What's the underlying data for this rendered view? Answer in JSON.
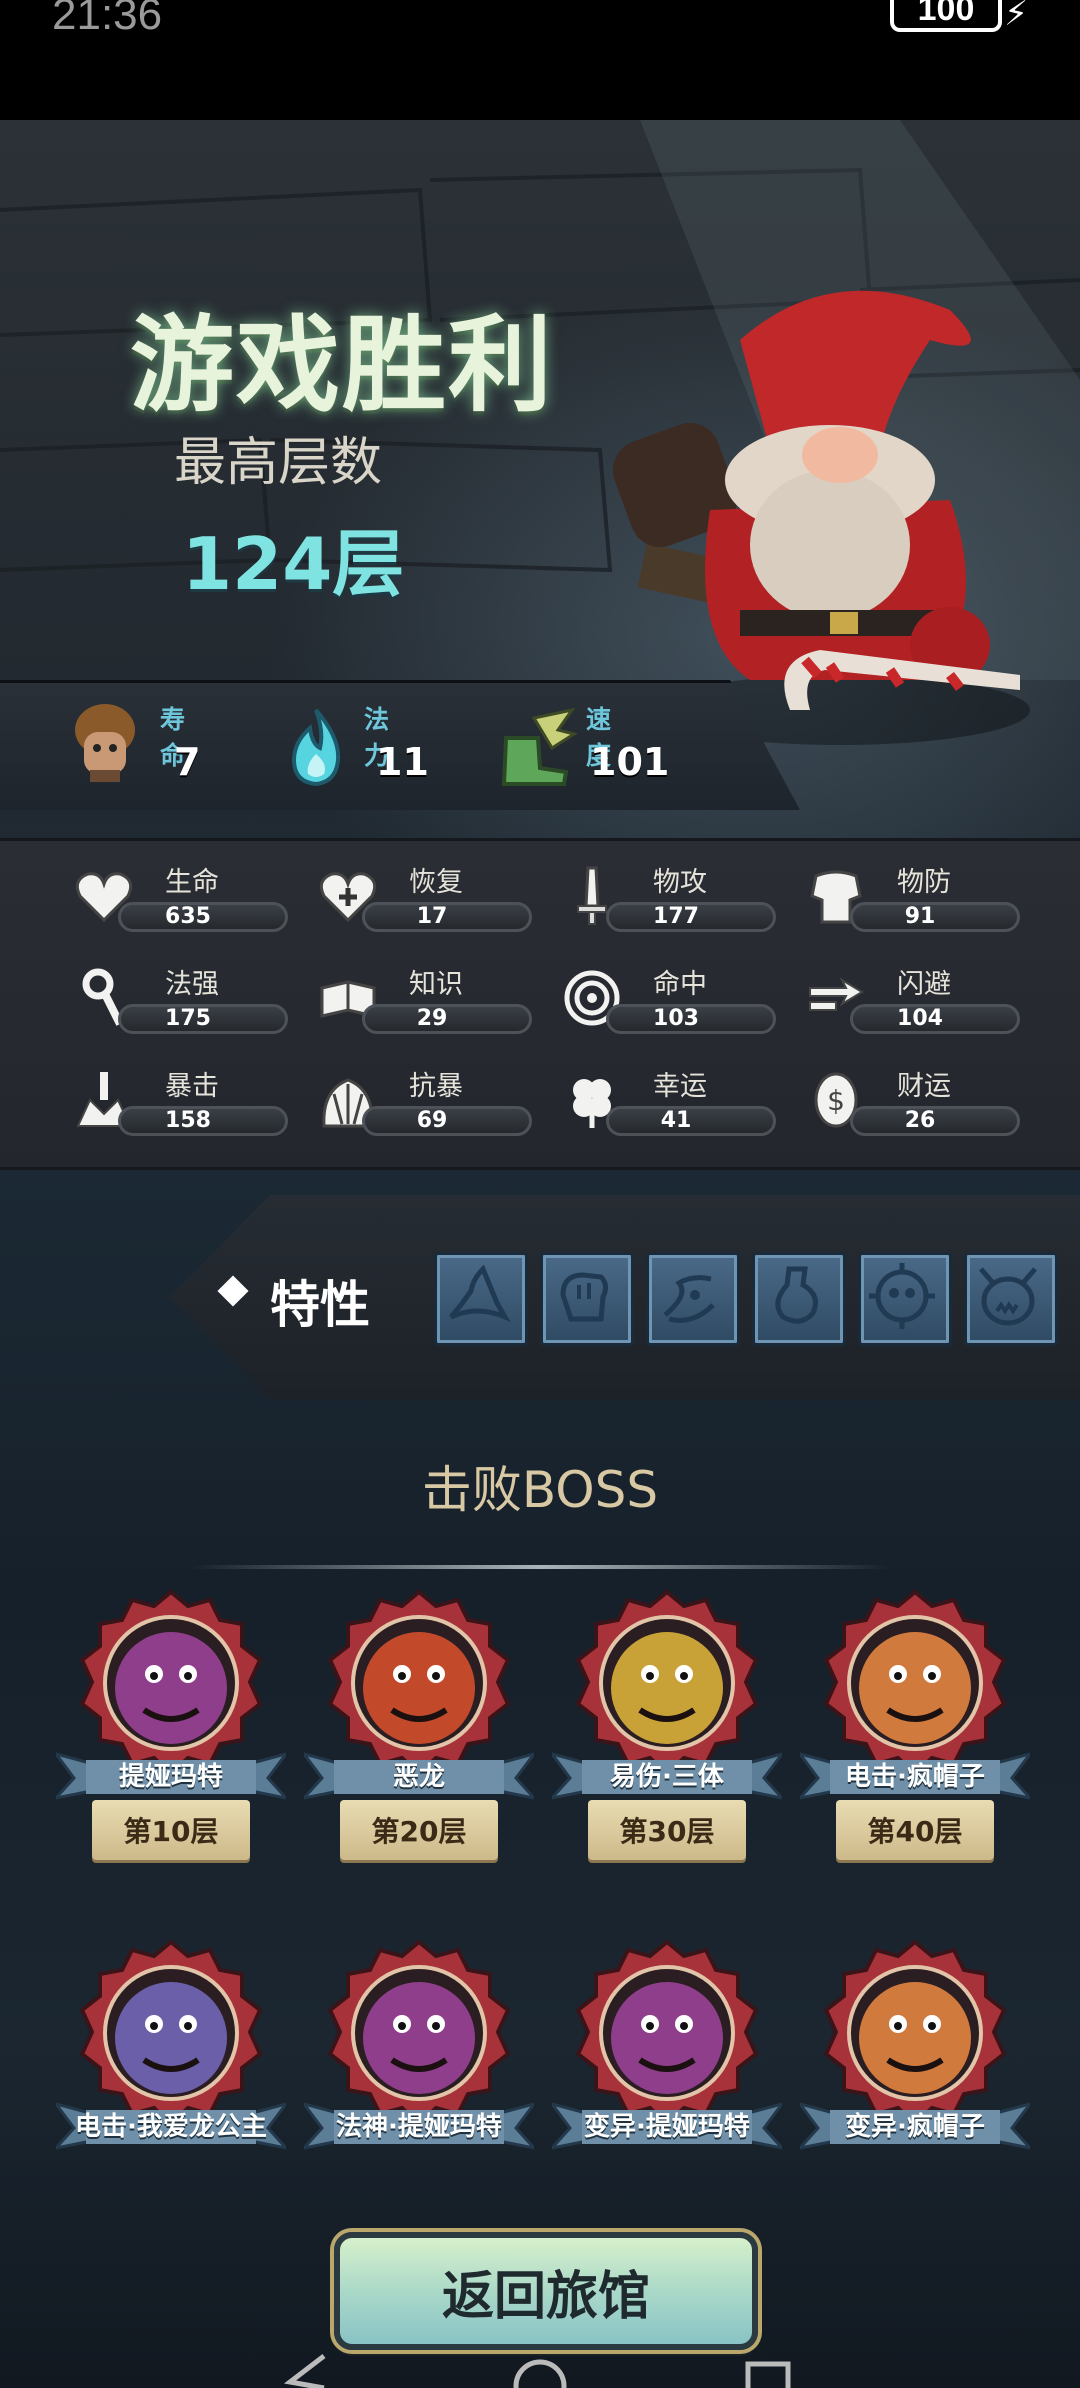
{
  "status": {
    "time": "21:36",
    "battery": "100"
  },
  "header": {
    "title": "游戏胜利",
    "max_floor_label": "最高层数",
    "max_floor_value": "124层"
  },
  "top_stats": [
    {
      "label": "寿命",
      "value": "7",
      "icon": "villager-icon"
    },
    {
      "label": "法力",
      "value": "11",
      "icon": "blue-flame-icon"
    },
    {
      "label": "速度",
      "value": "101",
      "icon": "winged-boot-icon"
    }
  ],
  "attributes": [
    {
      "label": "生命",
      "value": "635",
      "icon": "heart-icon"
    },
    {
      "label": "恢复",
      "value": "17",
      "icon": "heart-plus-icon"
    },
    {
      "label": "物攻",
      "value": "177",
      "icon": "sword-icon"
    },
    {
      "label": "物防",
      "value": "91",
      "icon": "armor-icon"
    },
    {
      "label": "法强",
      "value": "175",
      "icon": "magic-staff-icon"
    },
    {
      "label": "知识",
      "value": "29",
      "icon": "book-icon"
    },
    {
      "label": "命中",
      "value": "103",
      "icon": "target-icon"
    },
    {
      "label": "闪避",
      "value": "104",
      "icon": "dodge-arrows-icon"
    },
    {
      "label": "暴击",
      "value": "158",
      "icon": "crit-dagger-icon"
    },
    {
      "label": "抗暴",
      "value": "69",
      "icon": "shell-shield-icon"
    },
    {
      "label": "幸运",
      "value": "41",
      "icon": "clover-icon"
    },
    {
      "label": "财运",
      "value": "26",
      "icon": "coin-icon"
    }
  ],
  "traits": {
    "title": "特性",
    "items": [
      "wizard-hat-icon",
      "fist-icon",
      "scroll-map-icon",
      "potion-icon",
      "skull-gear-icon",
      "ogre-face-icon"
    ]
  },
  "boss_section": {
    "title": "击败BOSS",
    "bosses": [
      {
        "name": "提娅玛特",
        "floor": "第10层",
        "color": "#8e3e8a"
      },
      {
        "name": "恶龙",
        "floor": "第20层",
        "color": "#c24a2a"
      },
      {
        "name": "易伤·三体",
        "floor": "第30层",
        "color": "#c9a237"
      },
      {
        "name": "电击·疯帽子",
        "floor": "第40层",
        "color": "#d07a3e"
      },
      {
        "name": "电击·我爱龙公主",
        "floor": "",
        "color": "#6a5fa8"
      },
      {
        "name": "法神·提娅玛特",
        "floor": "",
        "color": "#8e3e8a"
      },
      {
        "name": "变异·提娅玛特",
        "floor": "",
        "color": "#8e3e8a"
      },
      {
        "name": "变异·疯帽子",
        "floor": "",
        "color": "#d07a3e"
      }
    ]
  },
  "return_button": {
    "label": "返回旅馆"
  }
}
